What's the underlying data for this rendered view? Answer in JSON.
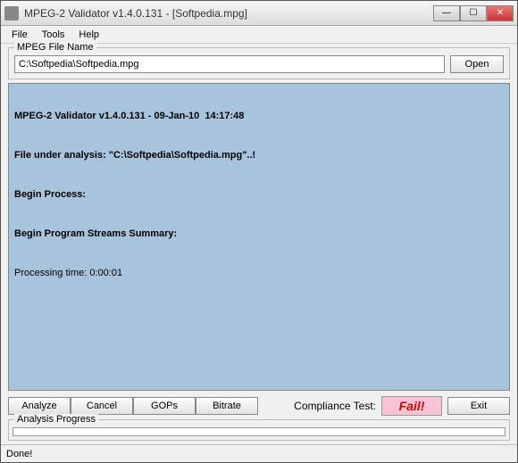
{
  "window": {
    "title": "MPEG-2 Validator v1.4.0.131 - [Softpedia.mpg]"
  },
  "menu": {
    "file": "File",
    "tools": "Tools",
    "help": "Help"
  },
  "file_group": {
    "legend": "MPEG File Name",
    "path": "C:\\Softpedia\\Softpedia.mpg",
    "open": "Open"
  },
  "output": {
    "line1": "MPEG-2 Validator v1.4.0.131 - 09-Jan-10  14:17:48",
    "line2": "File under analysis: \"C:\\Softpedia\\Softpedia.mpg\"..!",
    "line3": "Begin Process:",
    "line4": "Begin Program Streams Summary:",
    "line5": "Processing time: 0:00:01"
  },
  "buttons": {
    "analyze": "Analyze",
    "cancel": "Cancel",
    "gops": "GOPs",
    "bitrate": "Bitrate",
    "compliance_label": "Compliance Test:",
    "result": "Fail!",
    "exit": "Exit"
  },
  "progress": {
    "legend": "Analysis Progress"
  },
  "status": {
    "text": "Done!"
  }
}
